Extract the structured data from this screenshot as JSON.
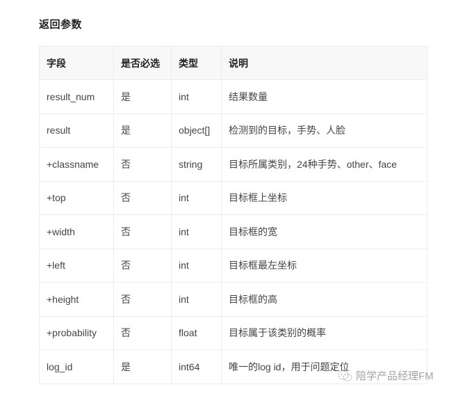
{
  "section": {
    "title": "返回参数"
  },
  "table": {
    "headers": [
      "字段",
      "是否必选",
      "类型",
      "说明"
    ],
    "rows": [
      {
        "field": "result_num",
        "required": "是",
        "type": "int",
        "desc": "结果数量"
      },
      {
        "field": "result",
        "required": "是",
        "type": "object[]",
        "desc": "检测到的目标，手势、人脸"
      },
      {
        "field": "+classname",
        "required": "否",
        "type": "string",
        "desc": "目标所属类别，24种手势、other、face"
      },
      {
        "field": "+top",
        "required": "否",
        "type": "int",
        "desc": "目标框上坐标"
      },
      {
        "field": "+width",
        "required": "否",
        "type": "int",
        "desc": "目标框的宽"
      },
      {
        "field": "+left",
        "required": "否",
        "type": "int",
        "desc": "目标框最左坐标"
      },
      {
        "field": "+height",
        "required": "否",
        "type": "int",
        "desc": "目标框的高"
      },
      {
        "field": "+probability",
        "required": "否",
        "type": "float",
        "desc": "目标属于该类别的概率"
      },
      {
        "field": "log_id",
        "required": "是",
        "type": "int64",
        "desc": "唯一的log id，用于问题定位"
      }
    ]
  },
  "watermark": {
    "icon": "wechat-icon",
    "text": "陪学产品经理FM"
  }
}
